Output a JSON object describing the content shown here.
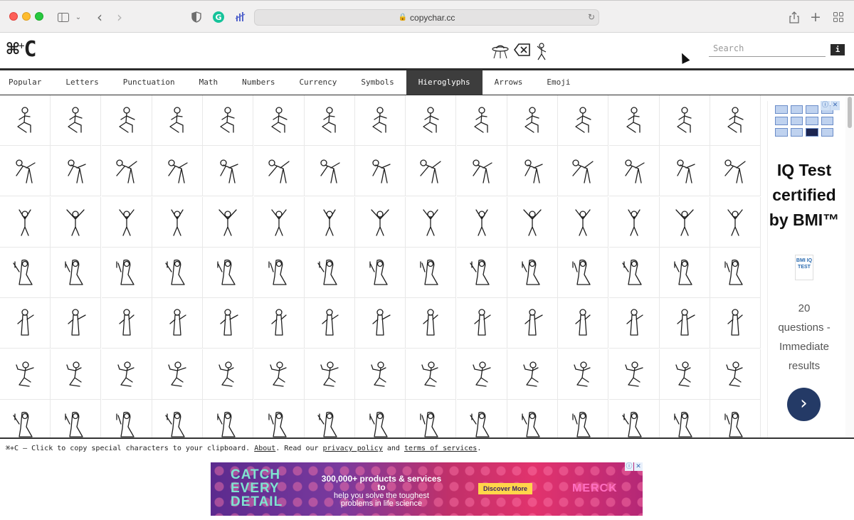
{
  "browser": {
    "url": "copychar.cc",
    "icons": [
      "sidebar-icon",
      "chevron-down-icon",
      "back-icon",
      "forward-icon",
      "shield-icon",
      "grammarly-icon",
      "extension-icon",
      "share-icon",
      "new-tab-icon",
      "tab-overview-icon"
    ]
  },
  "header": {
    "logo_main": "⌘",
    "logo_plus": "+",
    "logo_c": "C",
    "decor_glyphs": [
      "𓀀",
      "⌦",
      "𓀠"
    ],
    "search_placeholder": "Search",
    "info_label": "i"
  },
  "tabs": [
    {
      "label": "Popular",
      "active": false
    },
    {
      "label": "Letters",
      "active": false
    },
    {
      "label": "Punctuation",
      "active": false
    },
    {
      "label": "Math",
      "active": false
    },
    {
      "label": "Numbers",
      "active": false
    },
    {
      "label": "Currency",
      "active": false
    },
    {
      "label": "Symbols",
      "active": false
    },
    {
      "label": "Hieroglyphs",
      "active": true
    },
    {
      "label": "Arrows",
      "active": false
    },
    {
      "label": "Emoji",
      "active": false
    }
  ],
  "grid": {
    "rows": 7,
    "cols": 15,
    "row_types": [
      "seated",
      "bending",
      "arms-up",
      "kneeling",
      "tall-figure",
      "pose",
      "kneeling"
    ]
  },
  "ad_side": {
    "title_line1": "IQ Test",
    "title_line2": "certified",
    "title_line3": "by BMI™",
    "logo_text": "BMI IQ TEST",
    "sub_line1": "20",
    "sub_line2": "questions -",
    "sub_line3": "Immediate",
    "sub_line4": "results",
    "go_glyph": "›",
    "close_labels": [
      "ⓘ",
      "✕"
    ]
  },
  "footer": {
    "lead": "⌘+C – Click to copy special characters to your clipboard. ",
    "about": "About",
    "mid": ". Read our ",
    "privacy": "privacy policy",
    "and": " and ",
    "terms": "terms of services",
    "end": "."
  },
  "banner": {
    "catch_line1": "CATCH",
    "catch_line2": "EVERY",
    "catch_line3": "DETAIL",
    "mid_line1": "300,000+ products & services to",
    "mid_line2": "help you solve the toughest",
    "mid_line3": "problems in life science",
    "cta": "Discover More",
    "brand": "MERCK",
    "close_labels": [
      "ⓘ",
      "✕"
    ]
  }
}
